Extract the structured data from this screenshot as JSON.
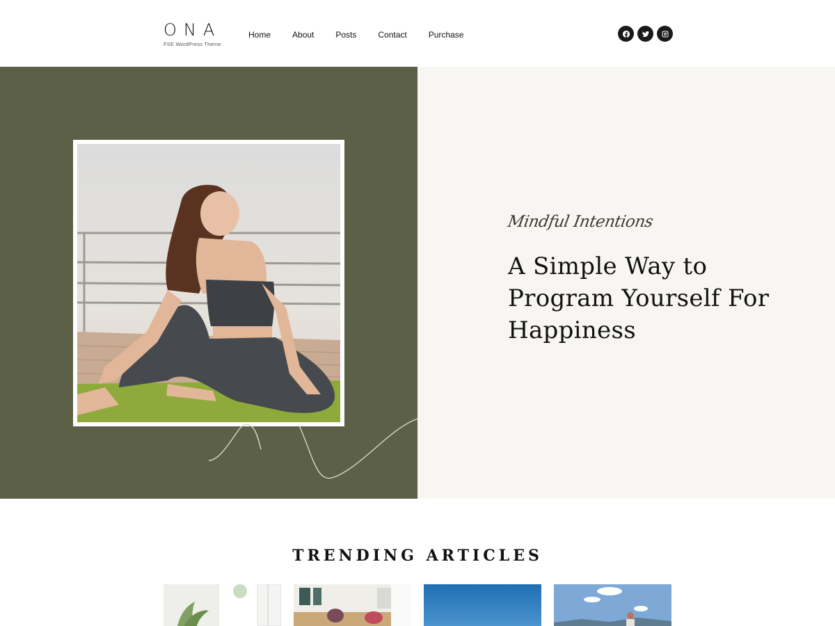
{
  "site": {
    "logo_title": "ONA",
    "logo_tagline": "FSE WordPress Theme"
  },
  "nav": {
    "items": [
      {
        "label": "Home"
      },
      {
        "label": "About"
      },
      {
        "label": "Posts"
      },
      {
        "label": "Contact"
      },
      {
        "label": "Purchase"
      }
    ]
  },
  "social": {
    "icons": [
      "facebook-icon",
      "twitter-icon",
      "instagram-icon"
    ]
  },
  "hero": {
    "script_text": "Mindful Intentions",
    "headline": "A Simple Way to Program Yourself For Happiness",
    "left_bg": "#5b6046",
    "right_bg": "#f8f6f2"
  },
  "trending": {
    "title": "TRENDING ARTICLES"
  }
}
